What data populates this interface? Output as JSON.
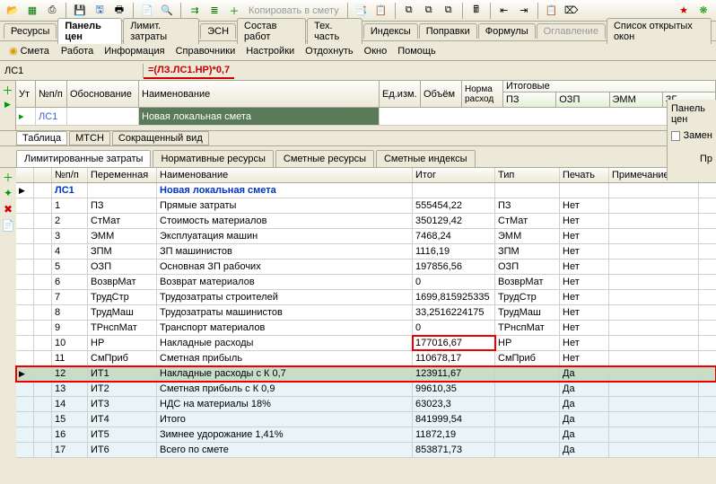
{
  "toolbar_tabs": [
    "Ресурсы",
    "Панель цен",
    "Лимит. затраты",
    "ЭСН",
    "Состав работ",
    "Тех. часть",
    "Индексы",
    "Поправки",
    "Формулы",
    "Оглавление",
    "Список открытых окон"
  ],
  "toolbar_tabs_active": 1,
  "toolbar_copy_label": "Копировать в смету",
  "menu": {
    "icon_label": "Смета",
    "items": [
      "Работа",
      "Информация",
      "Справочники",
      "Настройки",
      "Отдохнуть",
      "Окно",
      "Помощь"
    ]
  },
  "formula": {
    "name": "ЛС1",
    "value": "=(ЛЗ.ЛС1.НР)*0,7"
  },
  "top_grid": {
    "headers": [
      "Ут",
      "№п/п",
      "Обоснование",
      "Наименование",
      "Ед.изм.",
      "Объём",
      "Норма\nрасход"
    ],
    "itog_group": "Итоговые",
    "itog_cols": [
      "ПЗ",
      "ОЗП",
      "ЭММ",
      "ЗГ"
    ],
    "row": {
      "code": "ЛС1",
      "name": "Новая локальная смета"
    }
  },
  "mini_tabs": [
    "Таблица",
    "МТСН",
    "Сокращенный вид"
  ],
  "detail_tabs": [
    "Лимитированные затраты",
    "Нормативные ресурсы",
    "Сметные ресурсы",
    "Сметные индексы"
  ],
  "grid": {
    "headers": [
      "",
      "",
      "№п/п",
      "Переменная",
      "Наименование",
      "Итог",
      "Тип",
      "Печать",
      "Примечание"
    ],
    "title": {
      "code": "ЛС1",
      "name": "Новая локальная смета"
    },
    "rows": [
      {
        "n": "1",
        "var": "ПЗ",
        "name": "Прямые затраты",
        "itog": "555454,22",
        "tip": "ПЗ",
        "pech": "Нет"
      },
      {
        "n": "2",
        "var": "СтМат",
        "name": "Стоимость материалов",
        "itog": "350129,42",
        "tip": "СтМат",
        "pech": "Нет"
      },
      {
        "n": "3",
        "var": "ЭММ",
        "name": "Эксплуатация машин",
        "itog": "7468,24",
        "tip": "ЭММ",
        "pech": "Нет"
      },
      {
        "n": "4",
        "var": "ЗПМ",
        "name": "ЗП машинистов",
        "itog": "1116,19",
        "tip": "ЗПМ",
        "pech": "Нет"
      },
      {
        "n": "5",
        "var": "ОЗП",
        "name": "Основная ЗП рабочих",
        "itog": "197856,56",
        "tip": "ОЗП",
        "pech": "Нет"
      },
      {
        "n": "6",
        "var": "ВозврМат",
        "name": "Возврат материалов",
        "itog": "0",
        "tip": "ВозврМат",
        "pech": "Нет"
      },
      {
        "n": "7",
        "var": "ТрудСтр",
        "name": "Трудозатраты строителей",
        "itog": "1699,815925335",
        "tip": "ТрудСтр",
        "pech": "Нет"
      },
      {
        "n": "8",
        "var": "ТрудМаш",
        "name": "Трудозатраты машинистов",
        "itog": "33,2516224175",
        "tip": "ТрудМаш",
        "pech": "Нет"
      },
      {
        "n": "9",
        "var": "ТРнспМат",
        "name": "Транспорт материалов",
        "itog": "0",
        "tip": "ТРнспМат",
        "pech": "Нет"
      },
      {
        "n": "10",
        "var": "НР",
        "name": "Накладные расходы",
        "itog": "177016,67",
        "tip": "НР",
        "pech": "Нет",
        "hl_itog": true
      },
      {
        "n": "11",
        "var": "СмПриб",
        "name": "Сметная прибыль",
        "itog": "110678,17",
        "tip": "СмПриб",
        "pech": "Нет"
      },
      {
        "n": "12",
        "var": "ИТ1",
        "name": "Накладные расходы с К 0,7",
        "itog": "123911,67",
        "tip": "",
        "pech": "Да",
        "selected": true
      },
      {
        "n": "13",
        "var": "ИТ2",
        "name": "Сметная прибыль с К 0,9",
        "itog": "99610,35",
        "tip": "",
        "pech": "Да",
        "alt": true
      },
      {
        "n": "14",
        "var": "ИТ3",
        "name": "НДС на материалы  18%",
        "itog": "63023,3",
        "tip": "",
        "pech": "Да",
        "alt": true
      },
      {
        "n": "15",
        "var": "ИТ4",
        "name": "Итого",
        "itog": "841999,54",
        "tip": "",
        "pech": "Да",
        "alt": true
      },
      {
        "n": "16",
        "var": "ИТ5",
        "name": "Зимнее удорожание 1,41%",
        "itog": "11872,19",
        "tip": "",
        "pech": "Да",
        "alt": true
      },
      {
        "n": "17",
        "var": "ИТ6",
        "name": "Всего по смете",
        "itog": "853871,73",
        "tip": "",
        "pech": "Да",
        "alt": true
      }
    ]
  },
  "right_panel": {
    "title": "Панель цен",
    "checkbox": "Замен",
    "btn": "Пр"
  }
}
